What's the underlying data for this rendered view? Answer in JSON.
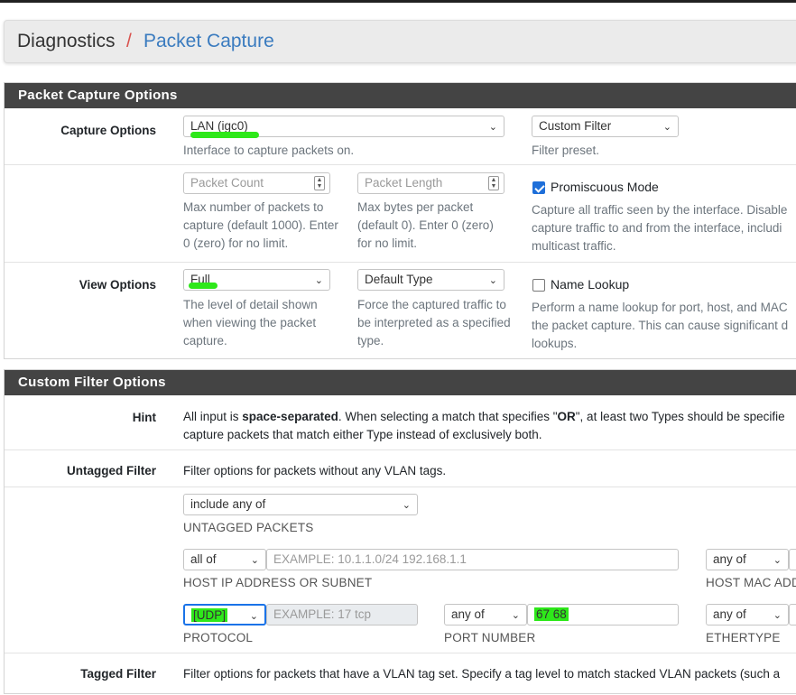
{
  "breadcrumb": {
    "root": "Diagnostics",
    "separator": "/",
    "current": "Packet Capture"
  },
  "capture_panel": {
    "title": "Packet Capture Options",
    "capture_options": {
      "label": "Capture Options",
      "interface": {
        "value": "LAN (igc0)",
        "help": "Interface to capture packets on."
      },
      "filter_preset": {
        "value": "Custom Filter",
        "help": "Filter preset."
      }
    },
    "limits": {
      "packet_count": {
        "placeholder": "Packet Count",
        "help": "Max number of packets to capture (default 1000). Enter 0 (zero) for no limit."
      },
      "packet_length": {
        "placeholder": "Packet Length",
        "help": "Max bytes per packet (default 0). Enter 0 (zero) for no limit."
      },
      "promiscuous": {
        "label": "Promiscuous Mode",
        "checked": true,
        "help": "Capture all traffic seen by the interface. Disable capture traffic to and from the interface, includi multicast traffic."
      }
    },
    "view_options": {
      "label": "View Options",
      "detail": {
        "value": "Full",
        "help": "The level of detail shown when viewing the packet capture."
      },
      "type": {
        "value": "Default Type",
        "help": "Force the captured traffic to be interpreted as a specified type."
      },
      "name_lookup": {
        "label": "Name Lookup",
        "checked": false,
        "help": "Perform a name lookup for port, host, and MAC the packet capture. This can cause significant d lookups."
      }
    }
  },
  "filter_panel": {
    "title": "Custom Filter Options",
    "hint": {
      "label": "Hint",
      "pre": "All input is ",
      "bold1": "space-separated",
      "mid": ". When selecting a match that specifies \"",
      "bold2": "OR",
      "post": "\", at least two Types should be specifie capture packets that match either Type instead of exclusively both."
    },
    "untagged": {
      "label": "Untagged Filter",
      "help": "Filter options for packets without any VLAN tags.",
      "match": {
        "value": "include any of",
        "caption": "UNTAGGED PACKETS"
      },
      "host_ip": {
        "match": "all of",
        "placeholder": "EXAMPLE: 10.1.1.0/24 192.168.1.1",
        "caption": "HOST IP ADDRESS OR SUBNET"
      },
      "host_mac": {
        "match": "any of",
        "caption": "HOST MAC ADD"
      },
      "protocol": {
        "match": "[UDP]",
        "placeholder": "EXAMPLE: 17 tcp",
        "caption": "PROTOCOL"
      },
      "port": {
        "match": "any of",
        "value": "67 68",
        "caption": "PORT NUMBER"
      },
      "ethertype": {
        "match": "any of",
        "caption": "ETHERTYPE"
      }
    },
    "tagged": {
      "label": "Tagged Filter",
      "help": "Filter options for packets that have a VLAN tag set. Specify a tag level to match stacked VLAN packets (such a"
    }
  },
  "colors": {
    "panel_header": "#444444",
    "link": "#3a7bbf",
    "separator": "#d9534f",
    "highlight": "#2ee81a"
  }
}
